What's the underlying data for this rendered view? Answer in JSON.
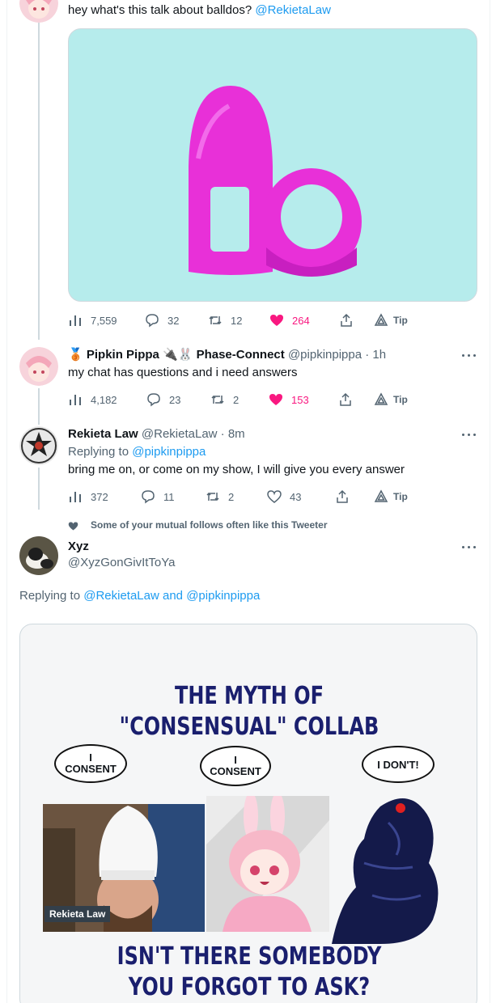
{
  "tweets": [
    {
      "text": "hey what's this talk about balldos?",
      "mention": "@RekietaLaw",
      "media": {
        "description_icon": "toy-image"
      },
      "stats": {
        "views": "7,559",
        "replies": "32",
        "retweets": "12",
        "likes": "264",
        "tip": "Tip"
      }
    },
    {
      "badge_emoji": "🥉",
      "display_name": "Pipkin Pippa",
      "name_emoji": "🔌🐰",
      "affiliation": "Phase-Connect",
      "handle": "@pipkinpippa",
      "time": "· 1h",
      "text": "my chat has questions and i need answers",
      "stats": {
        "views": "4,182",
        "replies": "23",
        "retweets": "2",
        "likes": "153",
        "tip": "Tip"
      }
    },
    {
      "display_name": "Rekieta Law",
      "handle": "@RekietaLaw",
      "time": "· 8m",
      "replying_prefix": "Replying to",
      "replying_to": "@pipkinpippa",
      "text": "bring me on, or come on my show, I will give you every answer",
      "stats": {
        "views": "372",
        "replies": "11",
        "retweets": "2",
        "likes": "43",
        "tip": "Tip"
      }
    }
  ],
  "suggestion": {
    "social_context": "Some of your mutual follows often like this Tweeter",
    "display_name": "Xyz",
    "handle": "@XyzGonGivItToYa",
    "replying_prefix": "Replying to",
    "replying_to_1": "@RekietaLaw",
    "replying_and": "and",
    "replying_to_2": "@pipkinpippa",
    "meme": {
      "title_line1": "THE MYTH OF",
      "title_line2_a": "\"CONSENSUAL\"",
      "title_line2_b": "COLLAB",
      "bubble1": "I CONSENT",
      "bubble2": "I CONSENT",
      "bubble3": "I DON'T!",
      "photo_caption": "Rekieta Law",
      "bottom_line1": "ISN'T THERE SOMEBODY",
      "bottom_line2": "YOU FORGOT TO ASK?"
    }
  },
  "colors": {
    "link": "#1d9bf0",
    "like": "#f91880",
    "muted": "#536471",
    "meme_blue": "#1a1f6e",
    "toy_pink": "#e830d8",
    "toy_bg": "#b6ecec"
  }
}
